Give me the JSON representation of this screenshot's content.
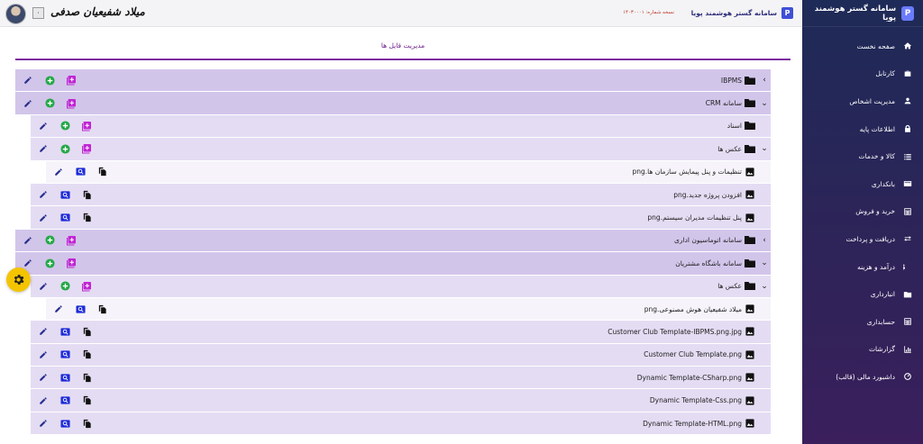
{
  "header": {
    "user_name": "میلاد شفیعیان صدفی",
    "user_badge": "٠",
    "app_title": "سامانه گستر هوشمند پویا",
    "version_text": "نسخه شماره: ١۴٠٣٠٠٠١"
  },
  "sidebar": {
    "brand": "سامانه گستر هوشمند پویا",
    "items": [
      {
        "label": "صفحه نخست",
        "icon": "home-icon"
      },
      {
        "label": "کارتابل",
        "icon": "briefcase-icon"
      },
      {
        "label": "مدیریت اشخاص",
        "icon": "user-icon"
      },
      {
        "label": "اطلاعات پایه",
        "icon": "lock-icon"
      },
      {
        "label": "کالا و خدمات",
        "icon": "list-icon"
      },
      {
        "label": "بانکداری",
        "icon": "card-icon"
      },
      {
        "label": "خرید و فروش",
        "icon": "calculator-icon"
      },
      {
        "label": "دریافت و پرداخت",
        "icon": "swap-icon"
      },
      {
        "label": "درآمد و هزینه",
        "icon": "dollar-icon"
      },
      {
        "label": "انبارداری",
        "icon": "folder-icon"
      },
      {
        "label": "حسابداری",
        "icon": "calculator-icon"
      },
      {
        "label": "گزارشات",
        "icon": "bar-chart-icon"
      },
      {
        "label": "داشبورد مالی (قالب)",
        "icon": "dashboard-icon"
      }
    ]
  },
  "page": {
    "title": "مدیریت فایل ها"
  },
  "tree": [
    {
      "level": 0,
      "type": "folder",
      "name": "IBPMS",
      "chevron": "›",
      "actions": [
        "add-folder",
        "add",
        "edit"
      ]
    },
    {
      "level": 0,
      "type": "folder",
      "name": "CRM سامانه",
      "chevron": "⌄",
      "actions": [
        "add-folder",
        "add",
        "edit"
      ]
    },
    {
      "level": 1,
      "type": "folder",
      "name": "اسناد",
      "chevron": "",
      "actions": [
        "add-folder",
        "add",
        "edit"
      ]
    },
    {
      "level": 1,
      "type": "folder",
      "name": "عکس ها",
      "chevron": "⌄",
      "actions": [
        "add-folder",
        "add",
        "edit"
      ]
    },
    {
      "level": 2,
      "type": "file",
      "name": "png.تنظیمات و پنل پیمایش سازمان ها",
      "chevron": "",
      "actions": [
        "copy",
        "view",
        "edit"
      ]
    },
    {
      "level": 1,
      "type": "file",
      "name": "png.افزودن پروژه جدید",
      "chevron": "",
      "actions": [
        "copy",
        "view",
        "edit"
      ]
    },
    {
      "level": 1,
      "type": "file",
      "name": "png.پنل تنظیمات مدیران سیستم",
      "chevron": "",
      "actions": [
        "copy",
        "view",
        "edit"
      ]
    },
    {
      "level": 0,
      "type": "folder",
      "name": "سامانه اتوماسیون اداری",
      "chevron": "›",
      "actions": [
        "add-folder",
        "add",
        "edit"
      ]
    },
    {
      "level": 0,
      "type": "folder",
      "name": "سامانه باشگاه مشتریان",
      "chevron": "⌄",
      "actions": [
        "add-folder",
        "add",
        "edit"
      ]
    },
    {
      "level": 1,
      "type": "folder",
      "name": "عکس ها",
      "chevron": "⌄",
      "actions": [
        "add-folder",
        "add",
        "edit"
      ]
    },
    {
      "level": 2,
      "type": "file",
      "name": "png.میلاد شفیعیان هوش مصنوعی",
      "chevron": "",
      "actions": [
        "copy",
        "view",
        "edit"
      ]
    },
    {
      "level": 1,
      "type": "file",
      "name": "Customer Club Template-IBPMS.png.jpg",
      "chevron": "",
      "actions": [
        "copy",
        "view",
        "edit"
      ]
    },
    {
      "level": 1,
      "type": "file",
      "name": "Customer Club Template.png",
      "chevron": "",
      "actions": [
        "copy",
        "view",
        "edit"
      ]
    },
    {
      "level": 1,
      "type": "file",
      "name": "Dynamic Template-CSharp.png",
      "chevron": "",
      "actions": [
        "copy",
        "view",
        "edit"
      ]
    },
    {
      "level": 1,
      "type": "file",
      "name": "Dynamic Template-Css.png",
      "chevron": "",
      "actions": [
        "copy",
        "view",
        "edit"
      ]
    },
    {
      "level": 1,
      "type": "file",
      "name": "Dynamic Template-HTML.png",
      "chevron": "",
      "actions": [
        "copy",
        "view",
        "edit"
      ]
    }
  ],
  "colors": {
    "sidebar": "#2b2558",
    "accent": "#7b2c9e",
    "folder_row": "#d2c5ea",
    "add_folder_icon": "#c026d3",
    "add_icon": "#22a845",
    "edit_icon": "#2a2f8f",
    "view_icon": "#1d2bd8",
    "gear": "#f5c400"
  }
}
